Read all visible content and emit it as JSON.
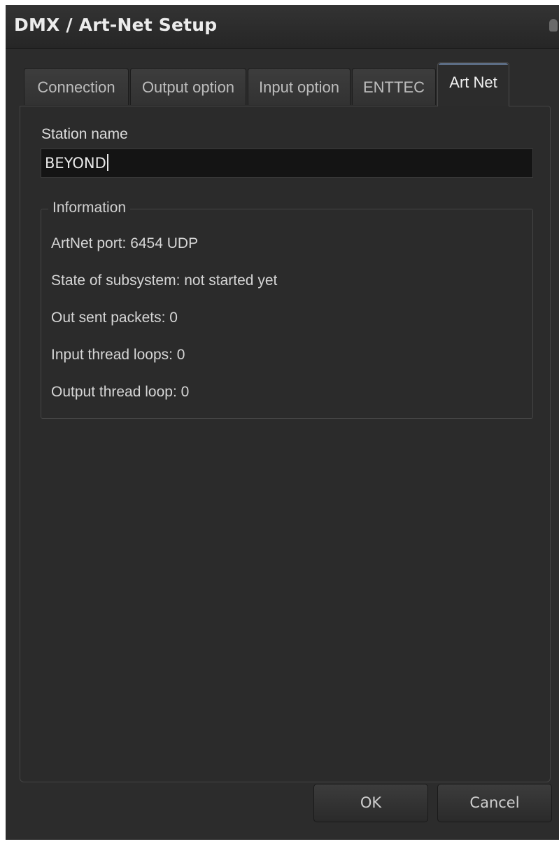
{
  "window": {
    "title": "DMX / Art-Net Setup"
  },
  "tabs": [
    {
      "label": "Connection",
      "active": false
    },
    {
      "label": "Output option",
      "active": false
    },
    {
      "label": "Input option",
      "active": false
    },
    {
      "label": "ENTTEC",
      "active": false
    },
    {
      "label": "Art Net",
      "active": true
    }
  ],
  "station": {
    "label": "Station name",
    "value": "BEYOND"
  },
  "information": {
    "legend": "Information",
    "lines": [
      "ArtNet port: 6454 UDP",
      "State of subsystem: not started yet",
      "Out sent packets: 0",
      "Input thread loops: 0",
      "Output thread loop: 0"
    ]
  },
  "buttons": {
    "ok": "OK",
    "cancel": "Cancel"
  },
  "colors": {
    "background": "#2c2c2c",
    "active_tab_accent": "#5d6e86",
    "input_background": "#141414"
  }
}
